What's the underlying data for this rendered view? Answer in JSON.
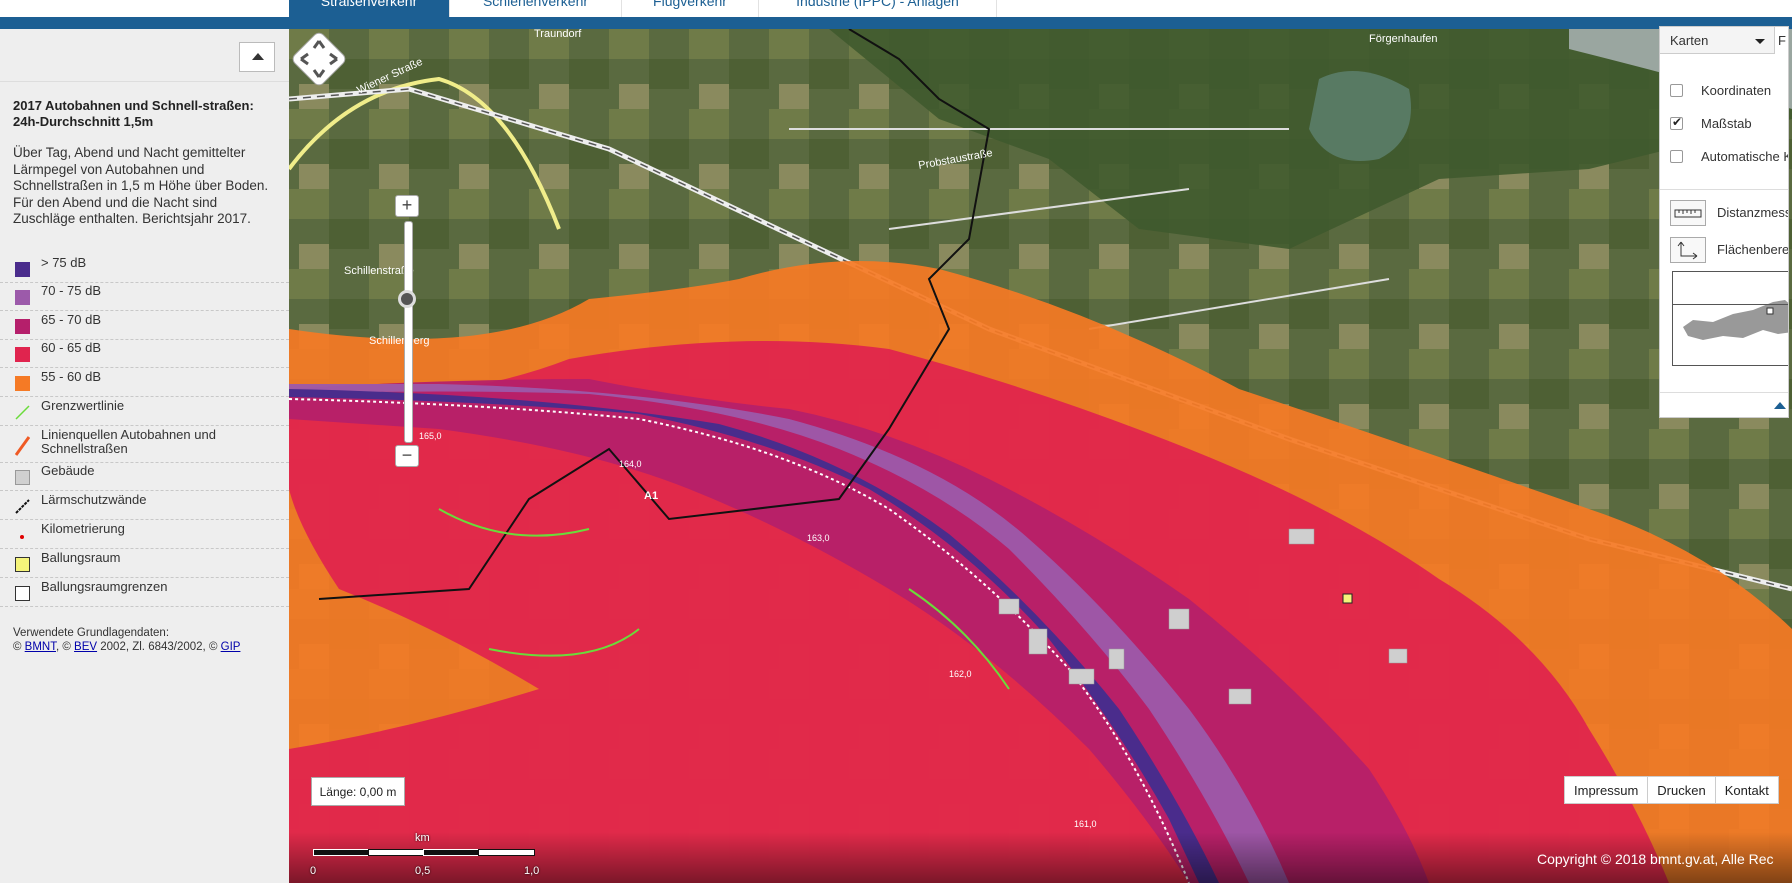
{
  "top_tabs": [
    {
      "label": "Straßenverkehr",
      "active": true
    },
    {
      "label": "Schienenverkehr",
      "active": false
    },
    {
      "label": "Flugverkehr",
      "active": false
    },
    {
      "label": "Industrie (IPPC) - Anlagen",
      "active": false
    }
  ],
  "legend": {
    "title": "2017 Autobahnen und Schnell-straßen: 24h-Durchschnitt 1,5m",
    "description": "Über Tag, Abend und Nacht gemittelter Lärmpegel von Autobahnen und Schnellstraßen in 1,5 m Höhe über Boden. Für den Abend und die Nacht sind Zuschläge enthalten. Berichtsjahr 2017.",
    "items": [
      {
        "label": "> 75 dB",
        "color": "#4a2c8c",
        "icon": "square"
      },
      {
        "label": "70 - 75 dB",
        "color": "#9c5aaa",
        "icon": "square"
      },
      {
        "label": "65 - 70 dB",
        "color": "#b51f6b",
        "icon": "square"
      },
      {
        "label": "60 - 65 dB",
        "color": "#e0244e",
        "icon": "square"
      },
      {
        "label": "55 - 60 dB",
        "color": "#f57a25",
        "icon": "square"
      },
      {
        "label": "Grenzwertlinie",
        "color": "#6adc3a",
        "icon": "green-line-icon"
      },
      {
        "label": "Linienquellen Autobahnen und Schnellstraßen",
        "color": "#ef5a24",
        "icon": "orange-line-icon"
      },
      {
        "label": "Gebäude",
        "color": "#d0d0d0",
        "icon": "square"
      },
      {
        "label": "Lärmschutzwände",
        "color": "#111111",
        "icon": "wall-line-icon"
      },
      {
        "label": "Kilometrierung",
        "color": "#e00000",
        "icon": "dot-icon"
      },
      {
        "label": "Ballungsraum",
        "color": "#f5f47a",
        "icon": "square"
      },
      {
        "label": "Ballungsraumgrenzen",
        "color": "#ffffff",
        "icon": "square-outline"
      }
    ],
    "source_prefix": "Verwendete Grundlagendaten:",
    "source_line": [
      "© ",
      "BMNT",
      ", © ",
      "BEV",
      " 2002, Zl. 6843/2002, © ",
      "GIP"
    ]
  },
  "map": {
    "measure_text": "Länge: 0,00 m",
    "zoom_in": "+",
    "zoom_out": "−",
    "zoom_level": 0.67,
    "scale_unit": "km",
    "scale_ticks": [
      "0",
      "0,5",
      "1,0"
    ],
    "footer_links": [
      "Impressum",
      "Drucken",
      "Kontakt"
    ],
    "copyright": "Copyright © 2018 bmnt.gv.at, Alle Rec",
    "labels": {
      "traundorf": "Traundorf",
      "wiener": "Wiener Straße",
      "probst": "Probstaustraße",
      "schillen": "Schillenstraße",
      "schillenberg": "Schillenberg",
      "forgen": "Förgenhaufen",
      "a1": "A1",
      "km165": "165,0",
      "km164": "164,0",
      "km163": "163,0",
      "km162": "162,0",
      "km161": "161,0"
    }
  },
  "panel": {
    "select_label": "Karten",
    "select2_label": "F",
    "checks": [
      {
        "label": "Koordinaten",
        "checked": false
      },
      {
        "label": "Maßstab",
        "checked": true
      },
      {
        "label": "Automatische K",
        "checked": false
      }
    ],
    "tools": [
      "Distanzmess",
      "Flächenbere"
    ]
  }
}
